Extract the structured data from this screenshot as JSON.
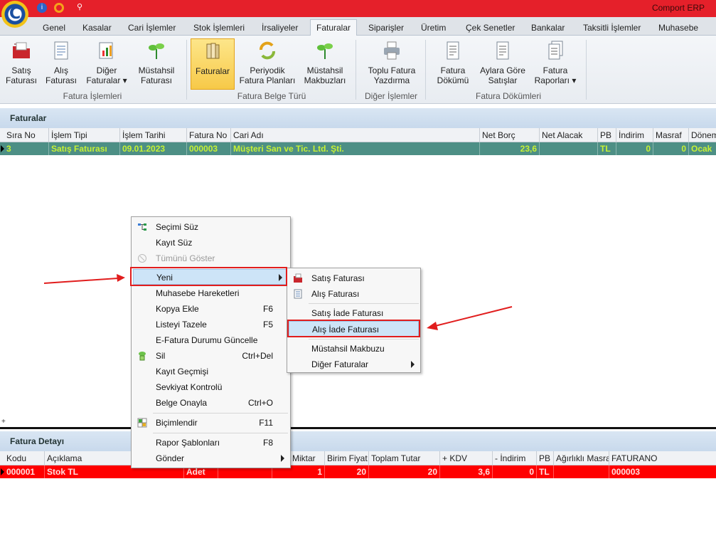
{
  "app": {
    "title": "Comport ERP"
  },
  "tabs": [
    {
      "label": "Genel"
    },
    {
      "label": "Kasalar"
    },
    {
      "label": "Cari İşlemler"
    },
    {
      "label": "Stok İşlemleri"
    },
    {
      "label": "İrsaliyeler"
    },
    {
      "label": "Faturalar"
    },
    {
      "label": "Siparişler"
    },
    {
      "label": "Üretim"
    },
    {
      "label": "Çek Senetler"
    },
    {
      "label": "Bankalar"
    },
    {
      "label": "Taksitli İşlemler"
    },
    {
      "label": "Muhasebe"
    }
  ],
  "ribbon": {
    "buttons": [
      {
        "label1": "Satış",
        "label2": "Faturası"
      },
      {
        "label1": "Alış",
        "label2": "Faturası"
      },
      {
        "label1": "Diğer",
        "label2": "Faturalar ▾"
      },
      {
        "label1": "Müstahsil",
        "label2": "Faturası"
      },
      {
        "label1": "Faturalar",
        "label2": ""
      },
      {
        "label1": "Periyodik",
        "label2": "Fatura Planları"
      },
      {
        "label1": "Müstahsil",
        "label2": "Makbuzları"
      },
      {
        "label1": "Toplu Fatura",
        "label2": "Yazdırma"
      },
      {
        "label1": "Fatura",
        "label2": "Dökümü"
      },
      {
        "label1": "Aylara Göre",
        "label2": "Satışlar"
      },
      {
        "label1": "Fatura",
        "label2": "Raporları ▾"
      }
    ],
    "groups": [
      "Fatura İşlemleri",
      "Fatura Belge Türü",
      "Diğer İşlemler",
      "Fatura Dökümleri"
    ]
  },
  "faturalar": {
    "title": "Faturalar",
    "columns": [
      "Sıra No",
      "İşlem Tipi",
      "İşlem Tarihi",
      "Fatura No",
      "Cari Adı",
      "Net Borç",
      "Net Alacak",
      "PB",
      "İndirim",
      "Masraf",
      "Dönem"
    ],
    "row": [
      "3",
      "Satış Faturası",
      "09.01.2023",
      "000003",
      "Müşteri San ve Tic. Ltd. Şti.",
      "23,6",
      "",
      "TL",
      "0",
      "0",
      "Ocak"
    ]
  },
  "detay": {
    "title": "Fatura Detayı",
    "columns": [
      "Kodu",
      "Açıklama",
      "",
      "",
      "Miktar",
      "Birim Fiyat",
      "Toplam Tutar",
      "+ KDV",
      "- İndirim",
      "PB",
      "Ağırlıklı Masraf",
      "FATURANO"
    ],
    "row": [
      "000001",
      "Stok TL",
      "Adet",
      "",
      "1",
      "20",
      "20",
      "3,6",
      "0",
      "TL",
      "",
      "000003"
    ]
  },
  "context_menu": {
    "items": [
      {
        "label": "Seçimi Süz",
        "shortcut": ""
      },
      {
        "label": "Kayıt Süz",
        "shortcut": ""
      },
      {
        "label": "Tümünü Göster",
        "shortcut": ""
      },
      {
        "label": "Yeni",
        "shortcut": ""
      },
      {
        "label": "Muhasebe Hareketleri",
        "shortcut": ""
      },
      {
        "label": "Kopya Ekle",
        "shortcut": "F6"
      },
      {
        "label": "Listeyi Tazele",
        "shortcut": "F5"
      },
      {
        "label": "E-Fatura Durumu Güncelle",
        "shortcut": ""
      },
      {
        "label": "Sil",
        "shortcut": "Ctrl+Del"
      },
      {
        "label": "Kayıt Geçmişi",
        "shortcut": ""
      },
      {
        "label": "Sevkiyat Kontrolü",
        "shortcut": ""
      },
      {
        "label": "Belge Onayla",
        "shortcut": "Ctrl+O"
      },
      {
        "label": "Biçimlendir",
        "shortcut": "F11"
      },
      {
        "label": "Rapor Şablonları",
        "shortcut": "F8"
      },
      {
        "label": "Gönder",
        "shortcut": ""
      }
    ]
  },
  "submenu": {
    "items": [
      {
        "label": "Satış Faturası"
      },
      {
        "label": "Alış Faturası"
      },
      {
        "label": "Satış İade Faturası"
      },
      {
        "label": "Alış İade Faturası"
      },
      {
        "label": "Müstahsil Makbuzu"
      },
      {
        "label": "Diğer Faturalar"
      }
    ]
  },
  "colors": {
    "title_red": "#e5202a",
    "row_green": "#4d8f85",
    "row_text_green": "#c6f135",
    "row_red": "#ff0000"
  }
}
